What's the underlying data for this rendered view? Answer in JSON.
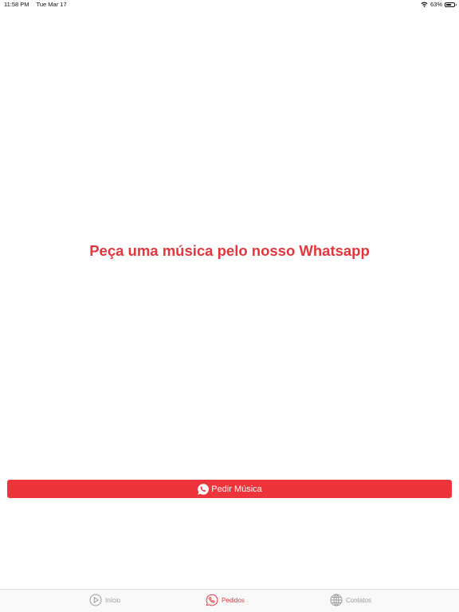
{
  "status_bar": {
    "time": "11:58 PM",
    "date": "Tue Mar 17",
    "battery_percent": "63%",
    "battery_level": 0.63
  },
  "main": {
    "headline": "Peça uma música pelo nosso Whatsapp",
    "request_button_label": "Pedir Música",
    "request_button_icon": "whatsapp-icon"
  },
  "tab_bar": {
    "tabs": [
      {
        "label": "Início",
        "icon": "play-circle-icon",
        "active": false
      },
      {
        "label": "Pedidos",
        "icon": "phone-bubble-icon",
        "active": true
      },
      {
        "label": "Contatos",
        "icon": "globe-icon",
        "active": false
      }
    ]
  },
  "colors": {
    "accent": "#e5363d",
    "button_background": "#ee343b",
    "inactive_tab": "#9b9b9b"
  }
}
